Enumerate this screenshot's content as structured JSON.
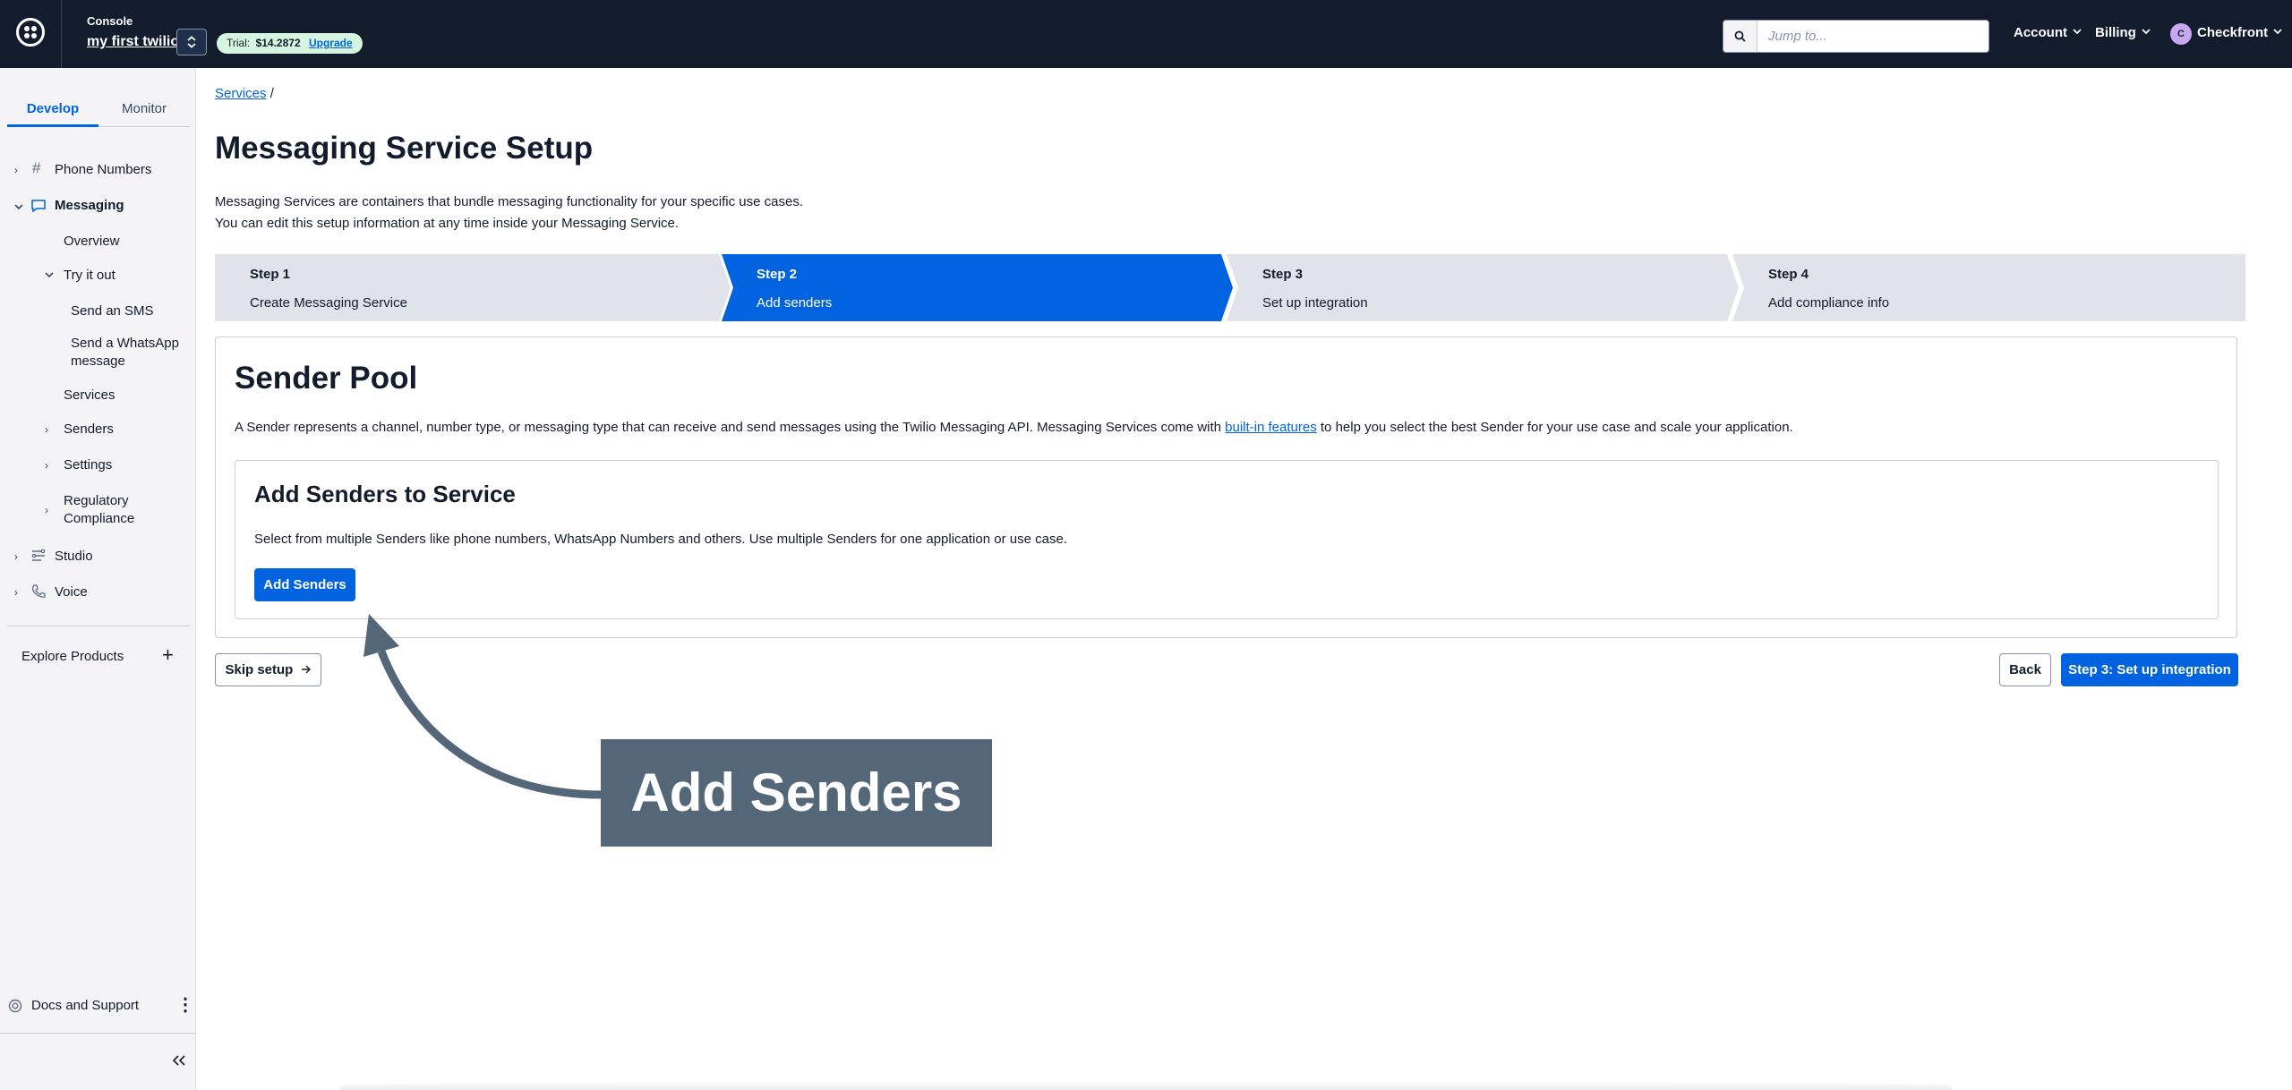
{
  "topbar": {
    "console_label": "Console",
    "account_name": "my first twilio",
    "trial_label": "Trial:",
    "trial_amount": "$14.2872",
    "upgrade_label": "Upgrade",
    "search_placeholder": "Jump to...",
    "account_menu": "Account",
    "billing_menu": "Billing",
    "user_initial": "C",
    "user_name": "Checkfront"
  },
  "sidebar": {
    "tabs": [
      "Develop",
      "Monitor"
    ],
    "items": {
      "phone_numbers": "Phone Numbers",
      "messaging": "Messaging",
      "overview": "Overview",
      "try_it_out": "Try it out",
      "send_sms": "Send an SMS",
      "send_whatsapp_1": "Send a WhatsApp",
      "send_whatsapp_2": "message",
      "services": "Services",
      "senders": "Senders",
      "settings": "Settings",
      "regulatory_1": "Regulatory",
      "regulatory_2": "Compliance",
      "studio": "Studio",
      "voice": "Voice"
    },
    "explore_products": "Explore Products",
    "docs_support": "Docs and Support"
  },
  "main": {
    "breadcrumb_link": "Services",
    "breadcrumb_sep": "/",
    "page_title": "Messaging Service Setup",
    "intro_line1": "Messaging Services are containers that bundle messaging functionality for your specific use cases.",
    "intro_line2": "You can edit this setup information at any time inside your Messaging Service.",
    "steps": [
      {
        "num": "Step 1",
        "desc": "Create Messaging Service"
      },
      {
        "num": "Step 2",
        "desc": "Add senders"
      },
      {
        "num": "Step 3",
        "desc": "Set up integration"
      },
      {
        "num": "Step 4",
        "desc": "Add compliance info"
      }
    ],
    "active_step": 2,
    "card": {
      "title": "Sender Pool",
      "desc_before": "A Sender represents a channel, number type, or messaging type that can receive and send messages using the Twilio Messaging API. Messaging Services come with ",
      "desc_link": "built-in features",
      "desc_after": " to help you select the best Sender for your use case and scale your application.",
      "inner_title": "Add Senders to Service",
      "inner_desc": "Select from multiple Senders like phone numbers, WhatsApp Numbers and others. Use multiple Senders for one application or use case.",
      "add_senders_button": "Add Senders"
    },
    "skip_setup": "Skip setup",
    "back_button": "Back",
    "next_button": "Step 3: Set up integration"
  },
  "annotation": {
    "callout_text": "Add Senders"
  },
  "colors": {
    "topbar_bg": "#121c2d",
    "primary": "#0263e0",
    "step_inactive": "#e1e3ea",
    "callout_bg": "#546779"
  }
}
